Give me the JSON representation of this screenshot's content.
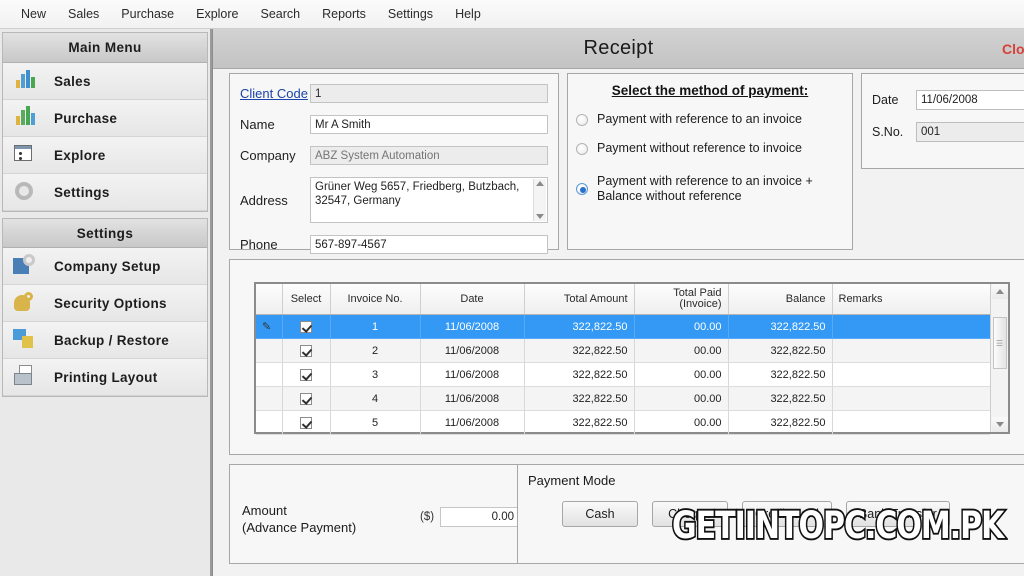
{
  "menubar": {
    "items": [
      {
        "label": "New",
        "name": "menu-new"
      },
      {
        "label": "Sales",
        "name": "menu-sales"
      },
      {
        "label": "Purchase",
        "name": "menu-purchase"
      },
      {
        "label": "Explore",
        "name": "menu-explore"
      },
      {
        "label": "Search",
        "name": "menu-search"
      },
      {
        "label": "Reports",
        "name": "menu-reports"
      },
      {
        "label": "Settings",
        "name": "menu-settings"
      },
      {
        "label": "Help",
        "name": "menu-help"
      }
    ]
  },
  "sidebar": {
    "groups": [
      {
        "header": "Main Menu",
        "items": [
          {
            "label": "Sales",
            "icon": "sales-chart-icon"
          },
          {
            "label": "Purchase",
            "icon": "purchase-chart-icon"
          },
          {
            "label": "Explore",
            "icon": "explore-window-icon"
          },
          {
            "label": "Settings",
            "icon": "gear-icon"
          }
        ]
      },
      {
        "header": "Settings",
        "items": [
          {
            "label": "Company Setup",
            "icon": "building-gear-icon"
          },
          {
            "label": "Security Options",
            "icon": "lock-key-icon"
          },
          {
            "label": "Backup / Restore",
            "icon": "backup-disk-icon"
          },
          {
            "label": "Printing Layout",
            "icon": "printer-icon"
          }
        ]
      }
    ]
  },
  "window": {
    "title": "Receipt",
    "close_label": "Close"
  },
  "client": {
    "code_label": "Client Code",
    "code_value": "1",
    "name_label": "Name",
    "name_value": "Mr A Smith",
    "company_label": "Company",
    "company_placeholder": "ABZ System Automation",
    "address_label": "Address",
    "address_value": "Grüner Weg 5657, Friedberg, Butzbach, 32547, Germany",
    "phone_label": "Phone",
    "phone_value": "567-897-4567"
  },
  "payment_method": {
    "title": "Select the method of payment:",
    "options": [
      {
        "label": "Payment with reference to an invoice",
        "selected": false
      },
      {
        "label": "Payment without reference to invoice",
        "selected": false
      },
      {
        "label": "Payment with reference to an invoice + Balance without reference",
        "selected": true
      }
    ]
  },
  "header_fields": {
    "date_label": "Date",
    "date_value": "11/06/2008",
    "sno_label": "S.No.",
    "sno_value": "001"
  },
  "invoice_grid": {
    "columns": [
      "Select",
      "Invoice No.",
      "Date",
      "Total Amount",
      "Total Paid (Invoice)",
      "Balance",
      "Remarks"
    ],
    "column_total_paid_line1": "Total Paid",
    "column_total_paid_line2": "(Invoice)",
    "rows": [
      {
        "select": true,
        "invoice_no": "1",
        "date": "11/06/2008",
        "total_amount": "322,822.50",
        "total_paid": "00.00",
        "balance": "322,822.50",
        "remarks": "",
        "selected": true
      },
      {
        "select": true,
        "invoice_no": "2",
        "date": "11/06/2008",
        "total_amount": "322,822.50",
        "total_paid": "00.00",
        "balance": "322,822.50",
        "remarks": "",
        "selected": false
      },
      {
        "select": true,
        "invoice_no": "3",
        "date": "11/06/2008",
        "total_amount": "322,822.50",
        "total_paid": "00.00",
        "balance": "322,822.50",
        "remarks": "",
        "selected": false
      },
      {
        "select": true,
        "invoice_no": "4",
        "date": "11/06/2008",
        "total_amount": "322,822.50",
        "total_paid": "00.00",
        "balance": "322,822.50",
        "remarks": "",
        "selected": false
      },
      {
        "select": true,
        "invoice_no": "5",
        "date": "11/06/2008",
        "total_amount": "322,822.50",
        "total_paid": "00.00",
        "balance": "322,822.50",
        "remarks": "",
        "selected": false
      }
    ]
  },
  "amount": {
    "label_line1": "Amount",
    "label_line2": "(Advance Payment)",
    "currency": "($)",
    "value": "0.00"
  },
  "payment_mode": {
    "title": "Payment Mode",
    "buttons": [
      {
        "label": "Cash"
      },
      {
        "label": "Cheque"
      },
      {
        "label": "Credit Card"
      },
      {
        "label": "Bank Transfer"
      }
    ]
  },
  "watermark": {
    "text": "GETIINTOPC.COM.PK"
  },
  "colors": {
    "selection_blue": "#3399f5",
    "link_blue": "#1b43a8",
    "close_red": "#d8403a"
  }
}
